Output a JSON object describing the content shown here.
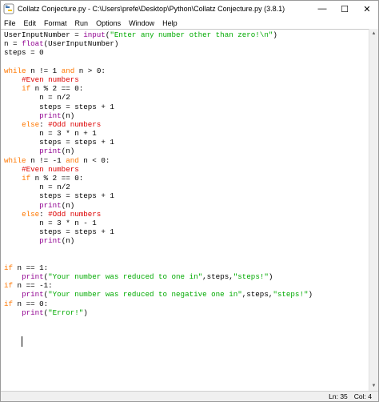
{
  "window": {
    "title": "Collatz Conjecture.py - C:\\Users\\prefe\\Desktop\\Python\\Collatz Conjecture.py (3.8.1)",
    "icon": "python-idle-icon"
  },
  "controls": {
    "minimize": "—",
    "maximize": "☐",
    "close": "✕"
  },
  "menu": {
    "items": [
      "File",
      "Edit",
      "Format",
      "Run",
      "Options",
      "Window",
      "Help"
    ]
  },
  "editor": {
    "language": "python",
    "lines": [
      "UserInputNumber = input(\"Enter any number other than zero!\\n\")",
      "n = float(UserInputNumber)",
      "steps = 0",
      "",
      "while n != 1 and n > 0:",
      "    #Even numbers",
      "    if n % 2 == 0:",
      "        n = n/2",
      "        steps = steps + 1",
      "        print(n)",
      "    else: #Odd numbers",
      "        n = 3 * n + 1",
      "        steps = steps + 1",
      "        print(n)",
      "while n != -1 and n < 0:",
      "    #Even numbers",
      "    if n % 2 == 0:",
      "        n = n/2",
      "        steps = steps + 1",
      "        print(n)",
      "    else: #Odd numbers",
      "        n = 3 * n - 1",
      "        steps = steps + 1",
      "        print(n)",
      "",
      "",
      "if n == 1:",
      "    print(\"Your number was reduced to one in\",steps,\"steps!\")",
      "if n == -1:",
      "    print(\"Your number was reduced to negative one in\",steps,\"steps!\")",
      "if n == 0:",
      "    print(\"Error!\")"
    ],
    "syntax_colors": {
      "keyword": "#ff7700",
      "builtin": "#900090",
      "string": "#00aa00",
      "comment": "#dd0000",
      "default": "#000000"
    }
  },
  "status": {
    "line": "Ln: 35",
    "col": "Col: 4"
  }
}
